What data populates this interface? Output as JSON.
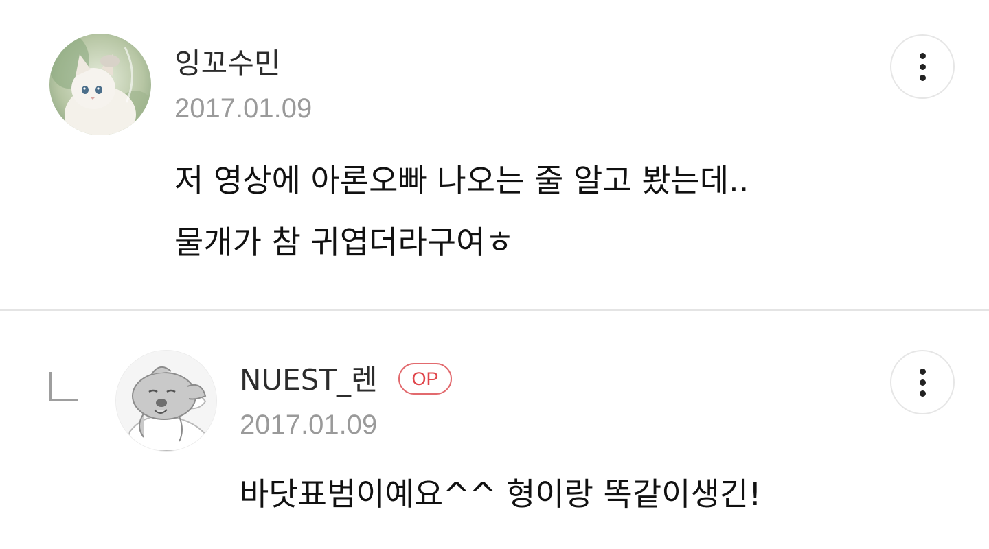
{
  "comments": [
    {
      "author": "잉꼬수민",
      "date": "2017.01.09",
      "avatar_icon": "cat-photo-avatar",
      "lines": [
        "저 영상에 아론오빠 나오는 줄 알고 봤는데..",
        "물개가 참 귀엽더라구여ㅎ"
      ]
    },
    {
      "author": "NUEST_렌",
      "badge": "OP",
      "date": "2017.01.09",
      "avatar_icon": "sleeping-dog-avatar",
      "is_reply": true,
      "lines": [
        "바닷표범이예요^^ 형이랑 똑같이생긴!"
      ]
    }
  ],
  "icons": {
    "more": "more-vertical-icon",
    "reply": "reply-corner-icon"
  },
  "colors": {
    "badge": "#e0454b",
    "date": "#9a9a9a",
    "divider": "#e4e4e4"
  }
}
